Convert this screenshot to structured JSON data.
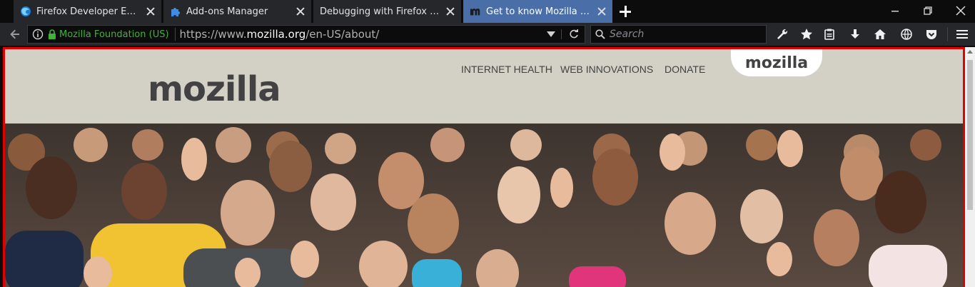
{
  "tabs": [
    {
      "title": "Firefox Developer Edition: Firefox Developer Edition Start",
      "favicon": "firefox-developer-icon"
    },
    {
      "title": "Add-ons Manager",
      "favicon": "puzzle-icon"
    },
    {
      "title": "Debugging with Firefox Developer Tools",
      "favicon": "none"
    },
    {
      "title": "Get to know Mozilla — Mozilla",
      "favicon": "mozilla-m-icon",
      "selected": true
    }
  ],
  "toolbar": {
    "identity": "Mozilla Foundation (US)",
    "url_prefix": "https://www.",
    "url_domain": "mozilla.org",
    "url_path": "/en-US/about/",
    "search_placeholder": "Search"
  },
  "site": {
    "logo": "mozilla",
    "tab_logo": "mozilla",
    "nav": [
      "INTERNET HEALTH",
      "WEB INNOVATIONS",
      "DONATE"
    ]
  },
  "colors": {
    "tabbar_bg": "#0c0c0d",
    "selected_tab": "#4a6fa8",
    "toolbar_bg": "#25272b",
    "identity_green": "#3fb23a",
    "header_bg": "#d3d0c6",
    "highlight_border": "#e00000"
  }
}
